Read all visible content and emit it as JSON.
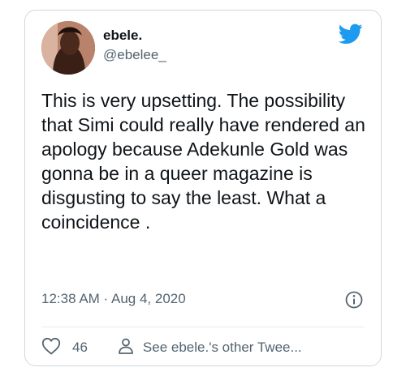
{
  "tweet": {
    "display_name": "ebele.",
    "handle": "@ebelee_",
    "text": "This is very upsetting. The possibility that Simi could really have rendered an apology because Adekunle Gold was gonna be in a queer magazine is disgusting to say the least. What a coincidence .",
    "timestamp": "12:38 AM · Aug 4, 2020",
    "likes": "46",
    "other_tweets_label": "See ebele.'s other Twee..."
  },
  "icons": {
    "brand": "twitter-bird-icon",
    "info": "info-icon",
    "like": "heart-icon",
    "profile": "person-icon"
  },
  "colors": {
    "brand": "#1d9bf0",
    "text": "#0f1419",
    "muted": "#536471",
    "border": "#cfd9de"
  }
}
